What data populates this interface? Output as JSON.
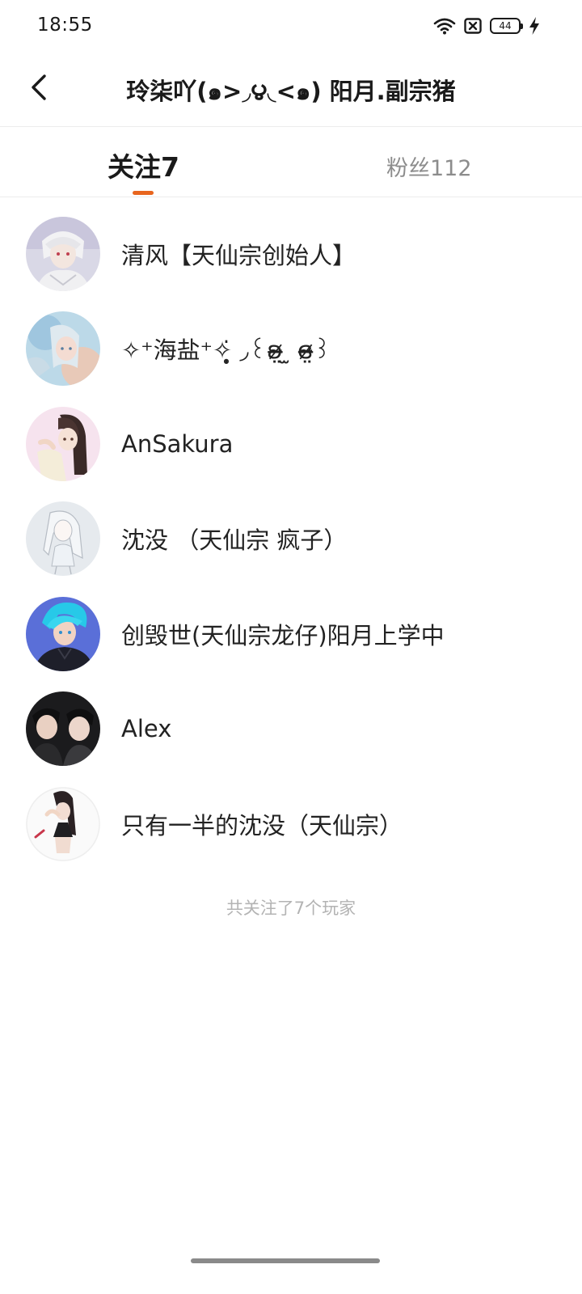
{
  "status_bar": {
    "time": "18:55",
    "battery": "44",
    "icons": [
      "wifi-icon",
      "no-sim-icon",
      "battery-icon",
      "charging-icon"
    ]
  },
  "header": {
    "title": "玲柒吖(๑>◞౪◟<๑) 阳月.副宗猪",
    "back_icon": "chevron-left-icon"
  },
  "tabs": [
    {
      "label": "关注7",
      "active": true
    },
    {
      "label": "粉丝112",
      "active": false
    }
  ],
  "colors": {
    "accent": "#e8651e",
    "text_primary": "#222222",
    "text_secondary": "#8c8c8c",
    "footer_text": "#b3b3b3"
  },
  "following": [
    {
      "name": "清风【天仙宗创始人】",
      "avatar": "avatar-silver-hair"
    },
    {
      "name": "✧⁺海盐⁺✧̣̥̇ ◞꒰ʚ̴̶̷̤ ̫ ɞ̴̶̷̤꒱",
      "avatar": "avatar-blue-watercolor"
    },
    {
      "name": "AnSakura",
      "avatar": "avatar-dark-hair-girl"
    },
    {
      "name": "沈没 （天仙宗 疯子）",
      "avatar": "avatar-white-sketch"
    },
    {
      "name": "创毁世(天仙宗龙仔)阳月上学中",
      "avatar": "avatar-cyan-hair"
    },
    {
      "name": "Alex",
      "avatar": "avatar-two-people-photo"
    },
    {
      "name": "只有一半的沈没（天仙宗）",
      "avatar": "avatar-ponytail-girl"
    }
  ],
  "footer": {
    "note": "共关注了7个玩家"
  }
}
